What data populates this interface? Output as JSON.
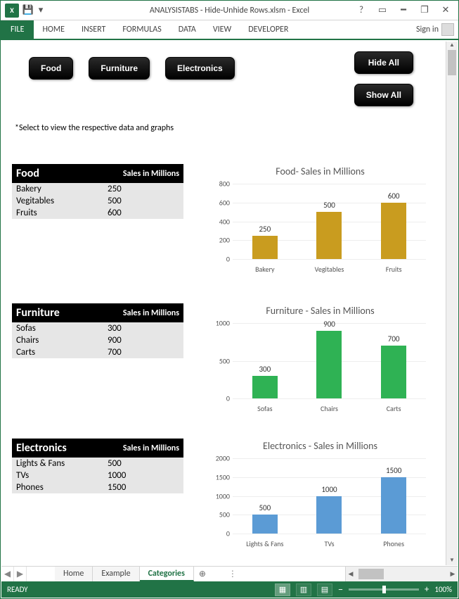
{
  "window": {
    "title": "ANALYSISTABS - Hide-Unhide Rows.xlsm - Excel"
  },
  "ribbon": {
    "file": "FILE",
    "tabs": [
      "HOME",
      "INSERT",
      "FORMULAS",
      "DATA",
      "VIEW",
      "DEVELOPER"
    ],
    "signin": "Sign in"
  },
  "buttons": {
    "food": "Food",
    "furniture": "Furniture",
    "electronics": "Electronics",
    "hide_all": "Hide All",
    "show_all": "Show All"
  },
  "hint": "*Select to view the respective data and graphs",
  "headers": {
    "sales": "Sales in Millions"
  },
  "categories": {
    "food": {
      "name": "Food",
      "rows": [
        {
          "label": "Bakery",
          "value": 250
        },
        {
          "label": "Vegitables",
          "value": 500
        },
        {
          "label": "Fruits",
          "value": 600
        }
      ]
    },
    "furniture": {
      "name": "Furniture",
      "rows": [
        {
          "label": "Sofas",
          "value": 300
        },
        {
          "label": "Chairs",
          "value": 900
        },
        {
          "label": "Carts",
          "value": 700
        }
      ]
    },
    "electronics": {
      "name": "Electronics",
      "rows": [
        {
          "label": "Lights & Fans",
          "value": 500
        },
        {
          "label": "TVs",
          "value": 1000
        },
        {
          "label": "Phones",
          "value": 1500
        }
      ]
    }
  },
  "chart_data": [
    {
      "type": "bar",
      "title": "Food- Sales in Millions",
      "categories": [
        "Bakery",
        "Vegitables",
        "Fruits"
      ],
      "values": [
        250,
        500,
        600
      ],
      "ylim": [
        0,
        800
      ],
      "yticks": [
        0,
        200,
        400,
        600,
        800
      ],
      "color": "#c99c1f"
    },
    {
      "type": "bar",
      "title": "Furniture - Sales in Millions",
      "categories": [
        "Sofas",
        "Chairs",
        "Carts"
      ],
      "values": [
        300,
        900,
        700
      ],
      "ylim": [
        0,
        1000
      ],
      "yticks": [
        0,
        500,
        1000
      ],
      "color": "#2fb254"
    },
    {
      "type": "bar",
      "title": "Electronics - Sales in Millions",
      "categories": [
        "Lights & Fans",
        "TVs",
        "Phones"
      ],
      "values": [
        500,
        1000,
        1500
      ],
      "ylim": [
        0,
        2000
      ],
      "yticks": [
        0,
        500,
        1000,
        1500,
        2000
      ],
      "color": "#5b9bd5"
    }
  ],
  "sheet_tabs": {
    "list": [
      "Home",
      "Example",
      "Categories"
    ],
    "active": "Categories"
  },
  "status": {
    "ready": "READY",
    "zoom": "100%"
  }
}
